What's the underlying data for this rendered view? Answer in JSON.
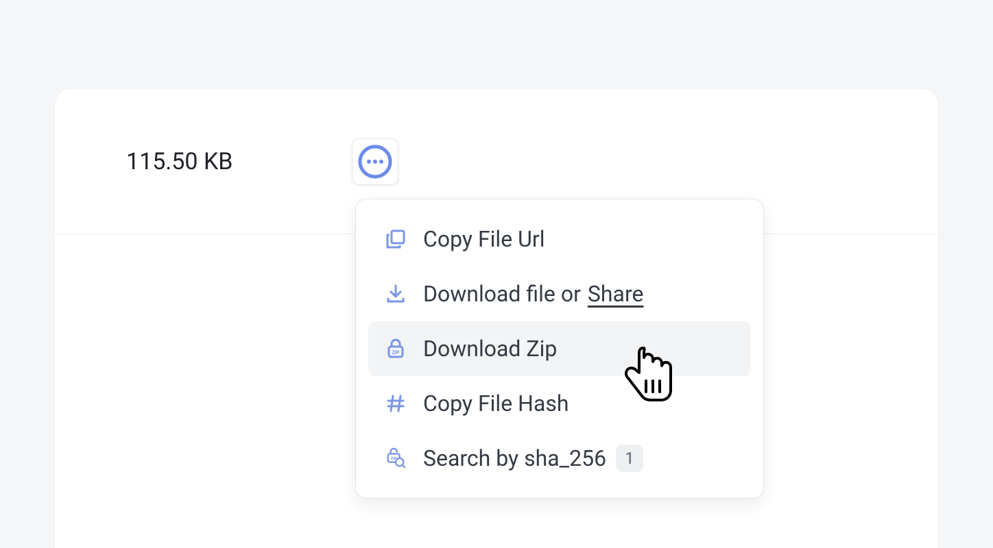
{
  "file": {
    "size": "115.50 KB"
  },
  "menu": {
    "copy_url": "Copy File Url",
    "download_prefix": "Download file or ",
    "download_share": "Share",
    "download_zip": "Download Zip",
    "copy_hash": "Copy File Hash",
    "search_sha": "Search by sha_256",
    "sha_badge": "1"
  }
}
